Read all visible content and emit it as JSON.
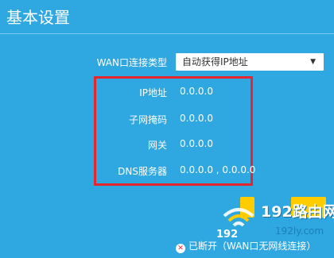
{
  "page": {
    "title": "基本设置"
  },
  "wan": {
    "label": "WAN口连接类型",
    "selected": "自动获得IP地址"
  },
  "fields": [
    {
      "label": "IP地址",
      "value": "0.0.0.0"
    },
    {
      "label": "子网掩码",
      "value": "0.0.0.0"
    },
    {
      "label": "网关",
      "value": "0.0.0.0"
    },
    {
      "label": "DNS服务器",
      "value": "0.0.0.0 , 0.0.0.0"
    }
  ],
  "status": {
    "text": "已断开（WAN口无网线连接）"
  },
  "watermark": {
    "ip": "192",
    "brand": "192路由网",
    "domain": "192ly.com"
  },
  "colors": {
    "background": "#2fa7e0",
    "highlight": "#e5262c",
    "button": "#ffcc00"
  }
}
